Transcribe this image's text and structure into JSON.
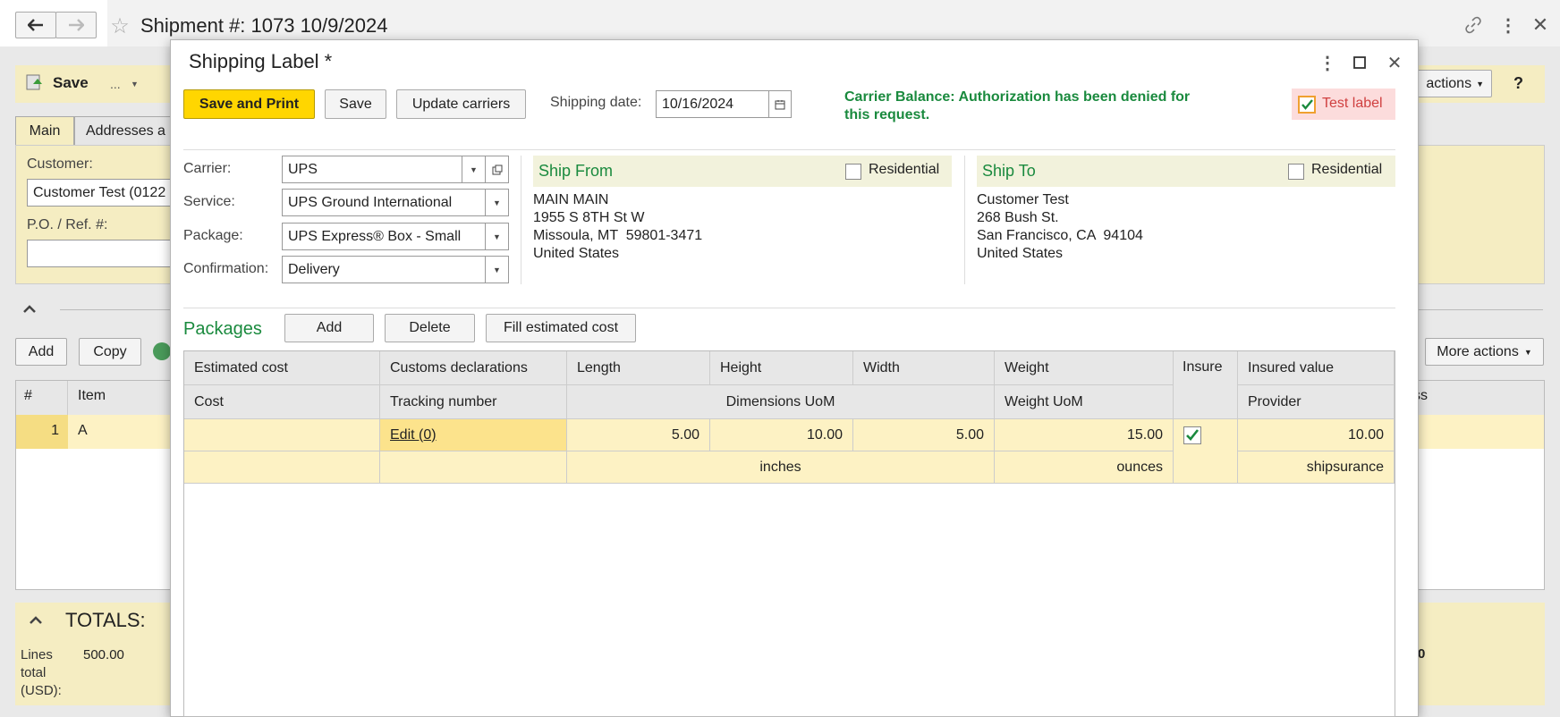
{
  "bg": {
    "title": "Shipment #: 1073 10/9/2024",
    "save_label": "Save",
    "ellipsis": "...",
    "tab_main": "Main",
    "tab_addresses": "Addresses a",
    "customer_label": "Customer:",
    "customer_value": "Customer Test (0122",
    "po_label": "P.O. / Ref. #:",
    "actions_label": "actions",
    "help": "?",
    "add_label": "Add",
    "copy_label": "Copy",
    "more_actions": "More actions",
    "col_hash": "#",
    "col_item": "Item",
    "col_right": "ss",
    "row_num": "1",
    "row_item": "A",
    "totals_title": "TOTALS:",
    "lines_total_label": "Lines total (USD):",
    "lines_total_value": "500.00",
    "right_value": "0"
  },
  "dialog": {
    "title": "Shipping Label *",
    "save_and_print": "Save and Print",
    "save": "Save",
    "update_carriers": "Update carriers",
    "shipping_date_label": "Shipping date:",
    "shipping_date_value": "10/16/2024",
    "carrier_balance": "Carrier Balance: Authorization has been denied for this request.",
    "test_label": "Test label",
    "carrier_label": "Carrier:",
    "carrier_value": "UPS",
    "service_label": "Service:",
    "service_value": "UPS Ground International",
    "package_label": "Package:",
    "package_value": "UPS Express® Box - Small",
    "confirmation_label": "Confirmation:",
    "confirmation_value": "Delivery",
    "ship_from": {
      "title": "Ship From",
      "residential": "Residential",
      "lines": [
        "MAIN MAIN",
        "1955 S 8TH St W",
        "Missoula, MT  59801-3471",
        "United States"
      ]
    },
    "ship_to": {
      "title": "Ship To",
      "residential": "Residential",
      "lines": [
        "Customer Test",
        "268 Bush St.",
        "San Francisco, CA  94104",
        "United States"
      ]
    },
    "packages_title": "Packages",
    "add": "Add",
    "delete": "Delete",
    "fill_estimated_cost": "Fill estimated cost",
    "headers_row1": [
      "Estimated cost",
      "Customs declarations",
      "Length",
      "Height",
      "Width",
      "Weight",
      "Insure",
      "Insured value"
    ],
    "headers_row2": [
      "Cost",
      "Tracking number",
      "Dimensions UoM",
      "Weight UoM",
      "Provider"
    ],
    "row1": {
      "customs": "Edit (0)",
      "length": "5.00",
      "height": "10.00",
      "width": "5.00",
      "weight": "15.00",
      "insured_value": "10.00"
    },
    "row2": {
      "dimensions_uom": "inches",
      "weight_uom": "ounces",
      "provider": "shipsurance"
    }
  },
  "colors": {
    "accent_green": "#1a8a3e",
    "yellow_button": "#ffd600",
    "row_yellow": "#fdf2c4"
  }
}
